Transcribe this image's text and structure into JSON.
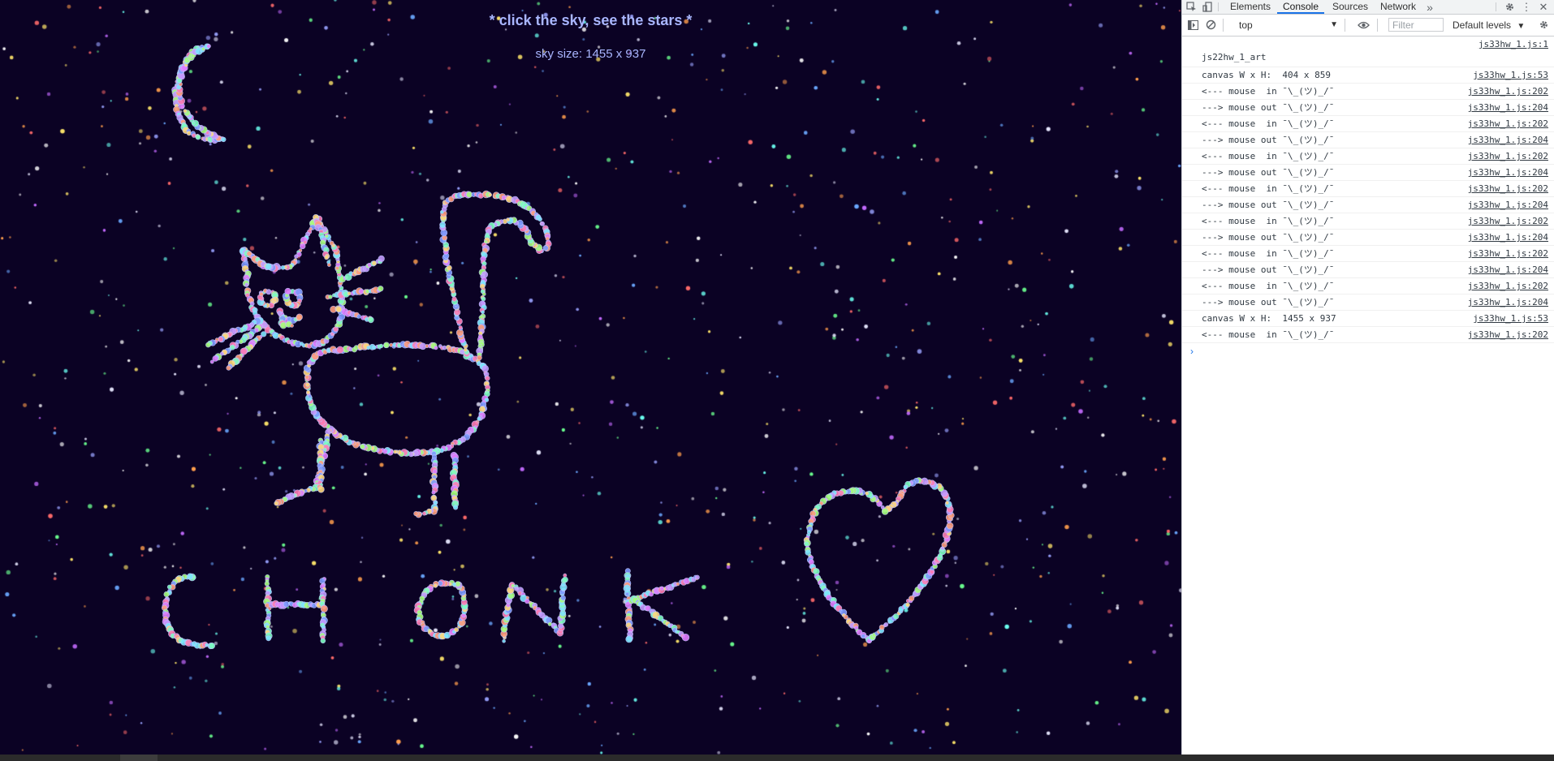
{
  "sky": {
    "title": "* click the sky, see the stars *",
    "size_label": "sky size: 1455 x 937",
    "background": "#0b0224",
    "art_words": "CHONK"
  },
  "devtools": {
    "tabs": [
      {
        "label": "Elements"
      },
      {
        "label": "Console"
      },
      {
        "label": "Sources"
      },
      {
        "label": "Network"
      }
    ],
    "more_tabs_icon": "double-chevron-icon",
    "context": "top",
    "filter_placeholder": "Filter",
    "levels_label": "Default levels",
    "logs": [
      {
        "msg": "js22hw_1_art",
        "src": "js33hw_1.js:1",
        "tall": true
      },
      {
        "msg": "canvas W x H:  404 x 859",
        "src": "js33hw_1.js:53"
      },
      {
        "msg": "<--- mouse  in ¯\\_(ツ)_/¯",
        "src": "js33hw_1.js:202"
      },
      {
        "msg": "---> mouse out ¯\\_(ツ)_/¯",
        "src": "js33hw_1.js:204"
      },
      {
        "msg": "<--- mouse  in ¯\\_(ツ)_/¯",
        "src": "js33hw_1.js:202"
      },
      {
        "msg": "---> mouse out ¯\\_(ツ)_/¯",
        "src": "js33hw_1.js:204"
      },
      {
        "msg": "<--- mouse  in ¯\\_(ツ)_/¯",
        "src": "js33hw_1.js:202"
      },
      {
        "msg": "---> mouse out ¯\\_(ツ)_/¯",
        "src": "js33hw_1.js:204"
      },
      {
        "msg": "<--- mouse  in ¯\\_(ツ)_/¯",
        "src": "js33hw_1.js:202"
      },
      {
        "msg": "---> mouse out ¯\\_(ツ)_/¯",
        "src": "js33hw_1.js:204"
      },
      {
        "msg": "<--- mouse  in ¯\\_(ツ)_/¯",
        "src": "js33hw_1.js:202"
      },
      {
        "msg": "---> mouse out ¯\\_(ツ)_/¯",
        "src": "js33hw_1.js:204"
      },
      {
        "msg": "<--- mouse  in ¯\\_(ツ)_/¯",
        "src": "js33hw_1.js:202"
      },
      {
        "msg": "---> mouse out ¯\\_(ツ)_/¯",
        "src": "js33hw_1.js:204"
      },
      {
        "msg": "<--- mouse  in ¯\\_(ツ)_/¯",
        "src": "js33hw_1.js:202"
      },
      {
        "msg": "---> mouse out ¯\\_(ツ)_/¯",
        "src": "js33hw_1.js:204"
      },
      {
        "msg": "canvas W x H:  1455 x 937",
        "src": "js33hw_1.js:53"
      },
      {
        "msg": "<--- mouse  in ¯\\_(ツ)_/¯",
        "src": "js33hw_1.js:202"
      }
    ],
    "prompt": "›"
  }
}
